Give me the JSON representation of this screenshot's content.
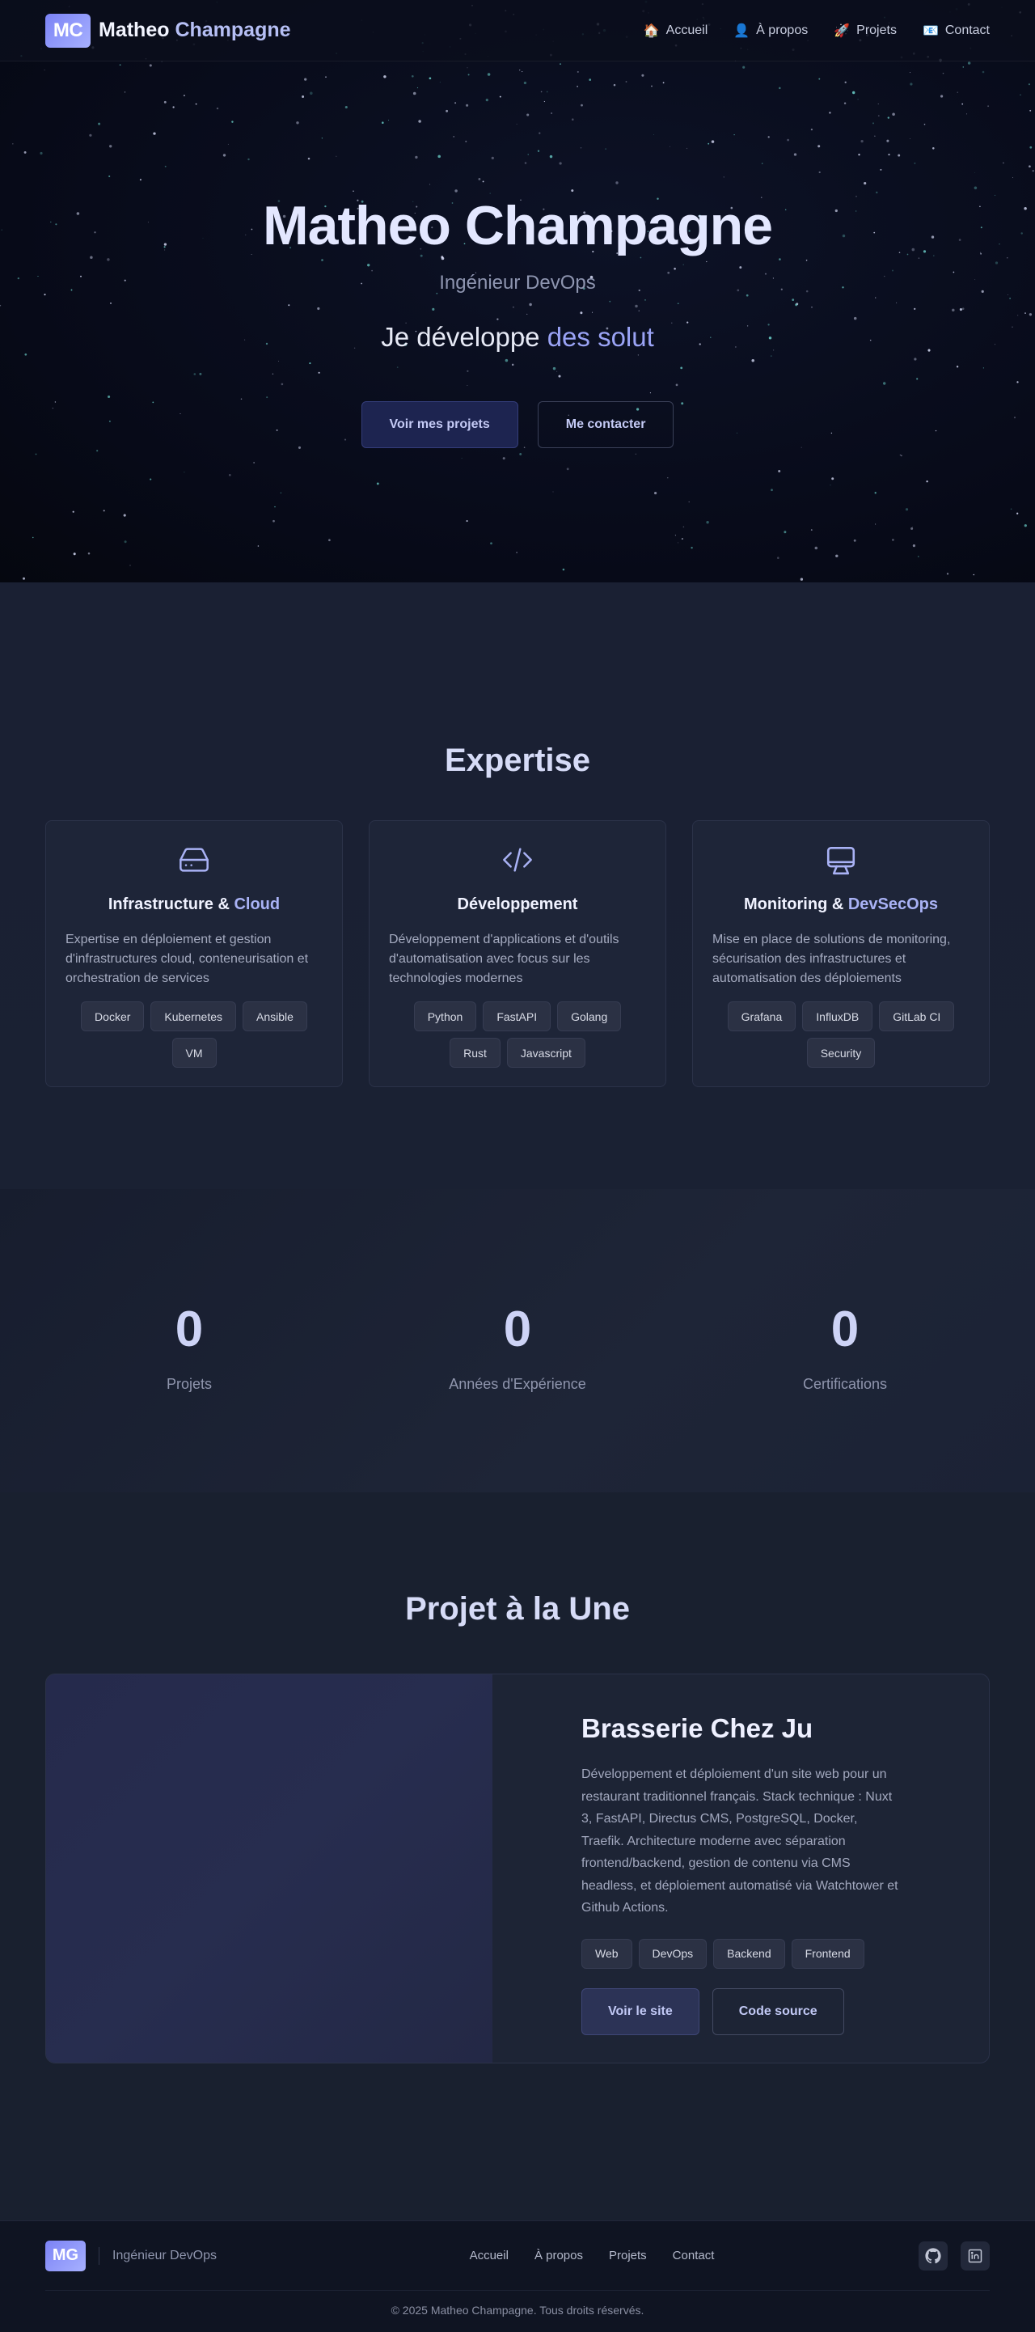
{
  "nav": {
    "logo": "MC",
    "brand_first": "Matheo",
    "brand_last": "Champagne",
    "links": [
      {
        "icon": "🏠",
        "label": "Accueil"
      },
      {
        "icon": "👤",
        "label": "À propos"
      },
      {
        "icon": "🚀",
        "label": "Projets"
      },
      {
        "icon": "📧",
        "label": "Contact"
      }
    ]
  },
  "hero": {
    "title": "Matheo Champagne",
    "subtitle": "Ingénieur DevOps",
    "tagline_prefix": "Je développe",
    "tagline_accent": "des solut",
    "primary_button": "Voir mes projets",
    "secondary_button": "Me contacter"
  },
  "expertise": {
    "title": "Expertise",
    "cards": [
      {
        "icon": "server-icon",
        "title_main": "Infrastructure & ",
        "title_accent": "Cloud",
        "description": "Expertise en déploiement et gestion d'infrastructures cloud, conteneurisation et orchestration de services",
        "tags": [
          "Docker",
          "Kubernetes",
          "Ansible",
          "VM"
        ]
      },
      {
        "icon": "code-icon",
        "title_main": "Développement",
        "title_accent": "",
        "description": "Développement d'applications et d'outils d'automatisation avec focus sur les technologies modernes",
        "tags": [
          "Python",
          "FastAPI",
          "Golang",
          "Rust",
          "Javascript"
        ]
      },
      {
        "icon": "monitor-icon",
        "title_main": "Monitoring & ",
        "title_accent": "DevSecOps",
        "description": "Mise en place de solutions de monitoring, sécurisation des infrastructures et automatisation des déploiements",
        "tags": [
          "Grafana",
          "InfluxDB",
          "GitLab CI",
          "Security"
        ]
      }
    ]
  },
  "stats": [
    {
      "value": "0",
      "label": "Projets"
    },
    {
      "value": "0",
      "label": "Années d'Expérience"
    },
    {
      "value": "0",
      "label": "Certifications"
    }
  ],
  "featured": {
    "title": "Projet à la Une",
    "project_title": "Brasserie Chez Ju",
    "description": "Développement et déploiement d'un site web pour un restaurant traditionnel français. Stack technique : Nuxt 3, FastAPI, Directus CMS, PostgreSQL, Docker, Traefik. Architecture moderne avec séparation frontend/backend, gestion de contenu via CMS headless, et déploiement automatisé via Watchtower et Github Actions.",
    "tags": [
      "Web",
      "DevOps",
      "Backend",
      "Frontend"
    ],
    "primary_button": "Voir le site",
    "secondary_button": "Code source"
  },
  "footer": {
    "logo": "MG",
    "role": "Ingénieur DevOps",
    "links": [
      "Accueil",
      "À propos",
      "Projets",
      "Contact"
    ],
    "socials": [
      "github-icon",
      "linkedin-icon"
    ],
    "copyright": "© 2025 Matheo Champagne. Tous droits réservés."
  }
}
